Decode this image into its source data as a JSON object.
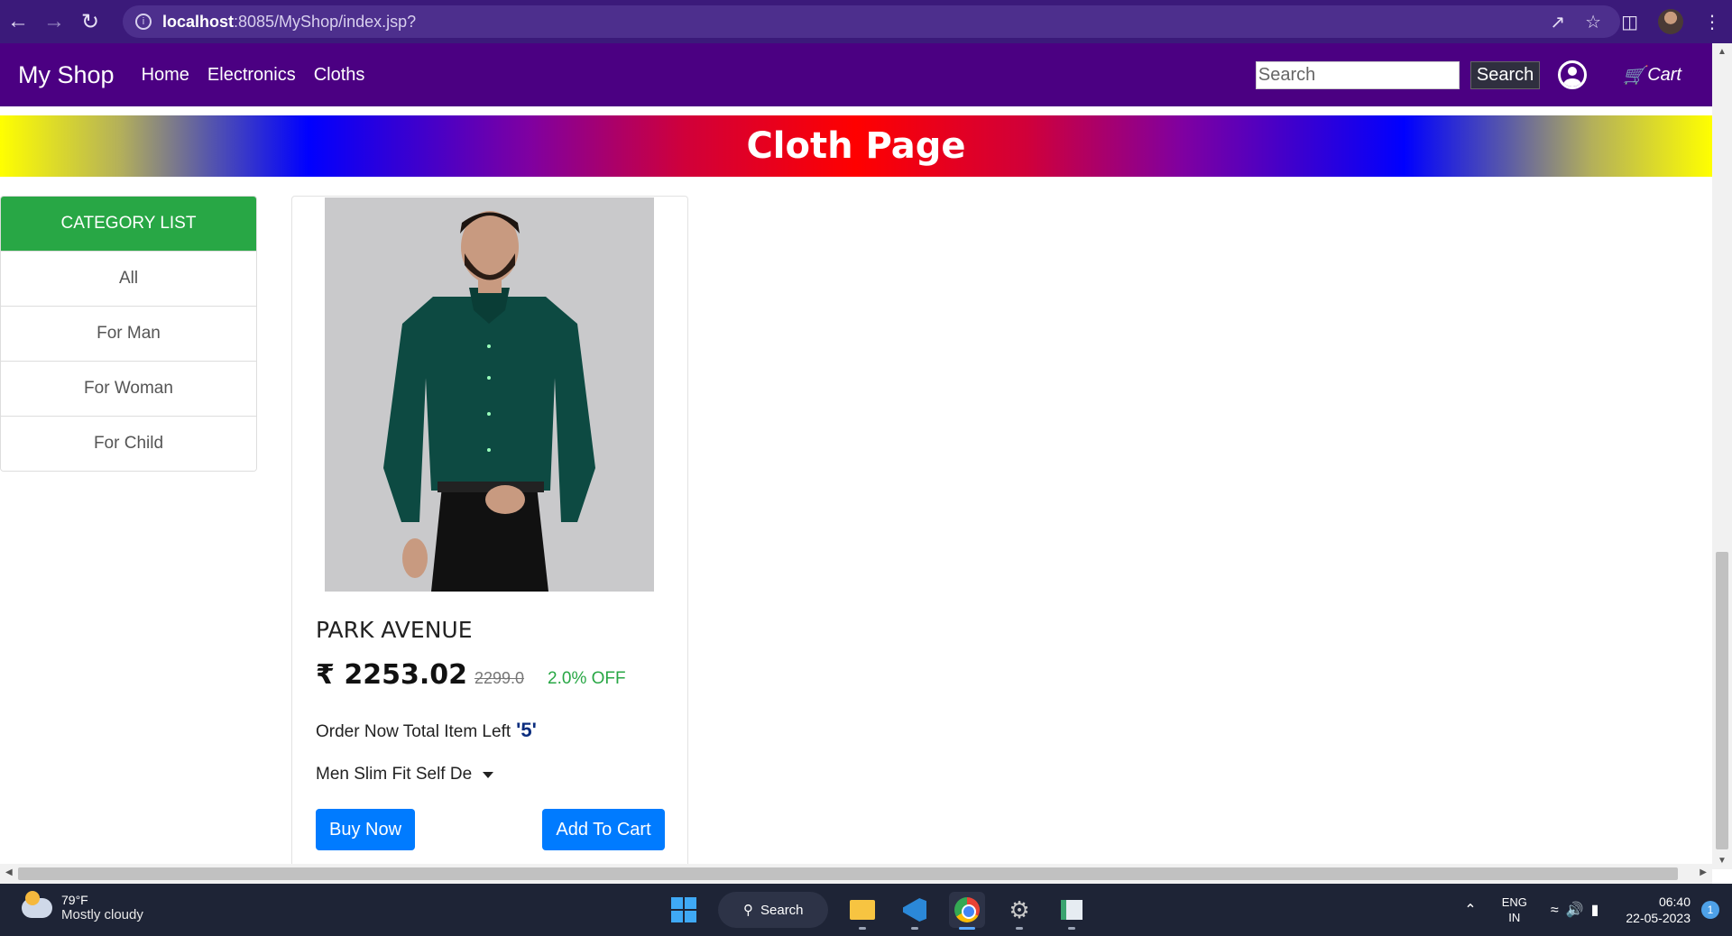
{
  "browser": {
    "url_host": "localhost",
    "url_rest": ":8085/MyShop/index.jsp?"
  },
  "navbar": {
    "brand": "My Shop",
    "links": [
      "Home",
      "Electronics",
      "Cloths"
    ],
    "search_placeholder": "Search",
    "search_button": "Search",
    "cart_label": "Cart"
  },
  "banner": {
    "title": "Cloth Page"
  },
  "category": {
    "header": "CATEGORY LIST",
    "items": [
      "All",
      "For Man",
      "For Woman",
      "For Child"
    ]
  },
  "product": {
    "title": "PARK AVENUE",
    "price": "₹ 2253.02",
    "old_price": "2299.0",
    "discount": "2.0% OFF",
    "stock_label": "Order Now Total Item Left",
    "stock_count": "'5'",
    "description": "Men Slim Fit Self De",
    "buy_label": "Buy Now",
    "cart_label": "Add To Cart"
  },
  "taskbar": {
    "temperature": "79°F",
    "weather": "Mostly cloudy",
    "search_label": "Search",
    "lang_line1": "ENG",
    "lang_line2": "IN",
    "time": "06:40",
    "date": "22-05-2023",
    "notifications": "1"
  },
  "colors": {
    "navbar": "#4b0082",
    "category_header": "#28a745",
    "button_primary": "#007bff",
    "discount": "#28a745"
  }
}
